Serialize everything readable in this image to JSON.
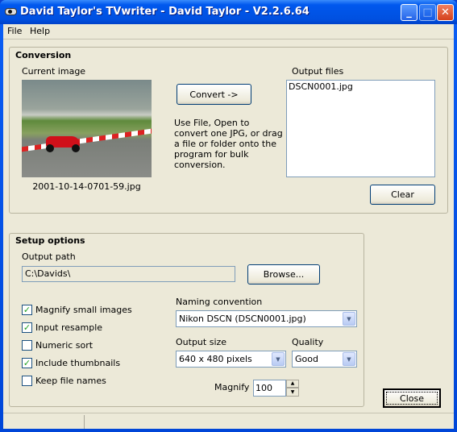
{
  "window": {
    "title": "David Taylor's TVwriter - David Taylor - V2.2.6.64",
    "icon": "app-icon",
    "buttons": {
      "minimize": "_",
      "maximize": "□",
      "close": "✕"
    }
  },
  "menu": [
    "File",
    "Help"
  ],
  "conversion": {
    "group_label": "Conversion",
    "current_image_label": "Current image",
    "image_caption": "2001-10-14-0701-59.jpg",
    "convert_label": "Convert ->",
    "instructions": "Use File, Open to convert one JPG, or drag a file or folder onto the program for bulk conversion.",
    "output_files_label": "Output files",
    "output_files": [
      "DSCN0001.jpg"
    ],
    "clear_label": "Clear"
  },
  "setup": {
    "group_label": "Setup options",
    "output_path_label": "Output path",
    "output_path": "C:\\Davids\\",
    "browse_label": "Browse...",
    "checkboxes": [
      {
        "label": "Magnify small images",
        "checked": true
      },
      {
        "label": "Input resample",
        "checked": true
      },
      {
        "label": "Numeric sort",
        "checked": false
      },
      {
        "label": "Include thumbnails",
        "checked": true
      },
      {
        "label": "Keep file names",
        "checked": false
      }
    ],
    "naming_label": "Naming convention",
    "naming_value": "Nikon DSCN (DSCN0001.jpg)",
    "output_size_label": "Output size",
    "output_size_value": "640 x 480 pixels",
    "quality_label": "Quality",
    "quality_value": "Good",
    "magnify_label": "Magnify",
    "magnify_value": "100"
  },
  "close_label": "Close"
}
